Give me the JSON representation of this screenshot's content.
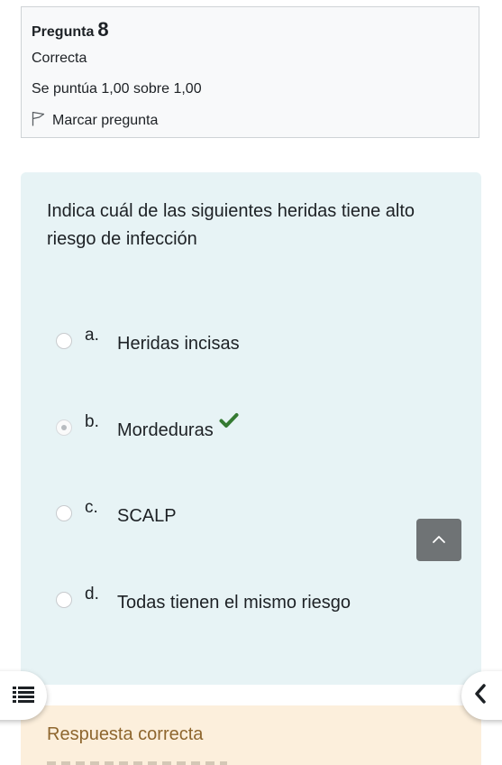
{
  "info": {
    "question_word": "Pregunta",
    "question_number": "8",
    "state": "Correcta",
    "grade": "Se puntúa 1,00 sobre 1,00",
    "flag_label": "Marcar pregunta"
  },
  "question": {
    "text": "Indica cuál de las siguientes heridas tiene alto riesgo de infección",
    "answers": [
      {
        "letter": "a.",
        "text": "Heridas incisas",
        "selected": false
      },
      {
        "letter": "b.",
        "text": "Mordeduras",
        "selected": true,
        "correct": true
      },
      {
        "letter": "c.",
        "text": "SCALP",
        "selected": false
      },
      {
        "letter": "d.",
        "text": "Todas tienen el mismo riesgo",
        "selected": false
      }
    ]
  },
  "feedback": {
    "title": "Respuesta correcta"
  },
  "icons": {
    "flag": "flag-outline-icon",
    "correct": "checkmark-icon",
    "back_to_top": "chevron-up-icon",
    "index_drawer": "list-icon",
    "blocks_drawer": "chevron-left-icon"
  },
  "colors": {
    "content_bg": "#e7f3f5",
    "info_bg": "#f8f9fa",
    "feedback_bg": "#fcefdc",
    "feedback_text": "#8e662e",
    "correct": "#357a32",
    "totop_bg": "#6f7375"
  }
}
